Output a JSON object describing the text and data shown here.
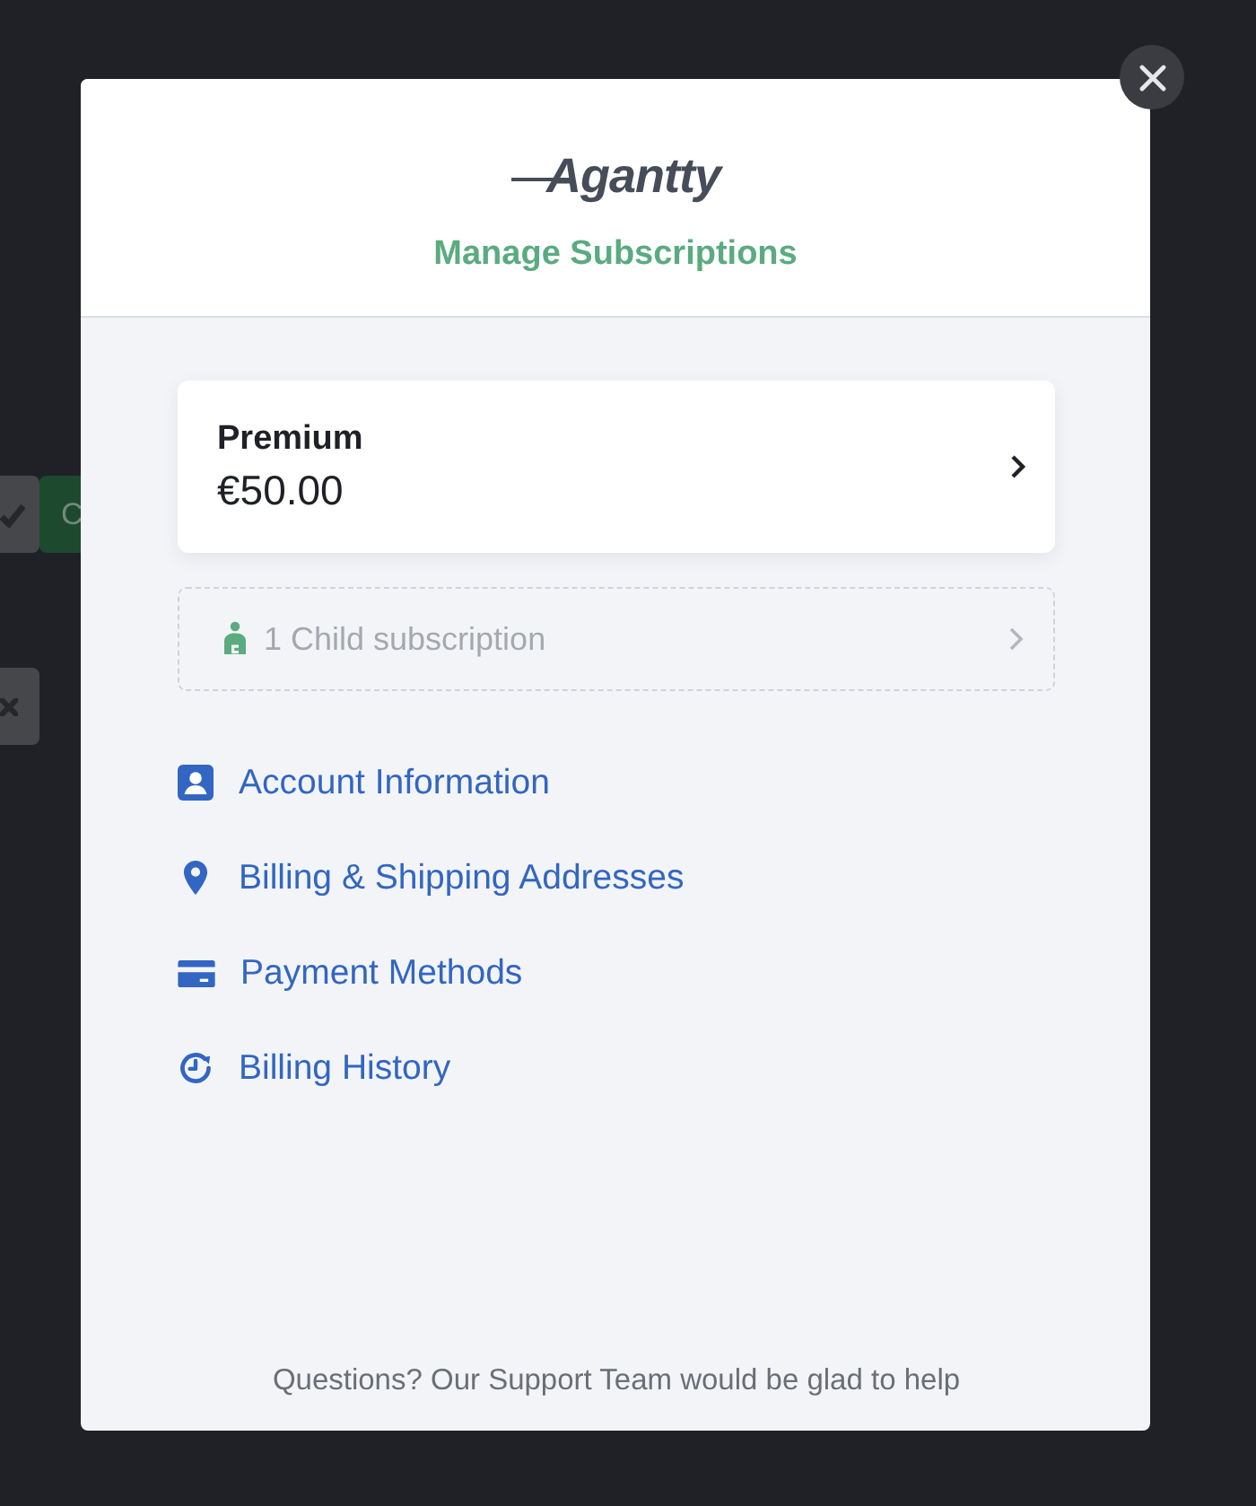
{
  "background": {
    "button_label": "C"
  },
  "modal": {
    "logo": "Agantty",
    "title": "Manage Subscriptions",
    "plan": {
      "name": "Premium",
      "price": "€50.00"
    },
    "child_subscriptions": {
      "label": "1 Child subscription",
      "disabled": true
    },
    "links": [
      {
        "kind": "account",
        "label": "Account Information"
      },
      {
        "kind": "location",
        "label": "Billing & Shipping Addresses"
      },
      {
        "kind": "card",
        "label": "Payment Methods"
      },
      {
        "kind": "history",
        "label": "Billing History"
      }
    ],
    "footer": "Questions? Our Support Team would be glad to help"
  }
}
